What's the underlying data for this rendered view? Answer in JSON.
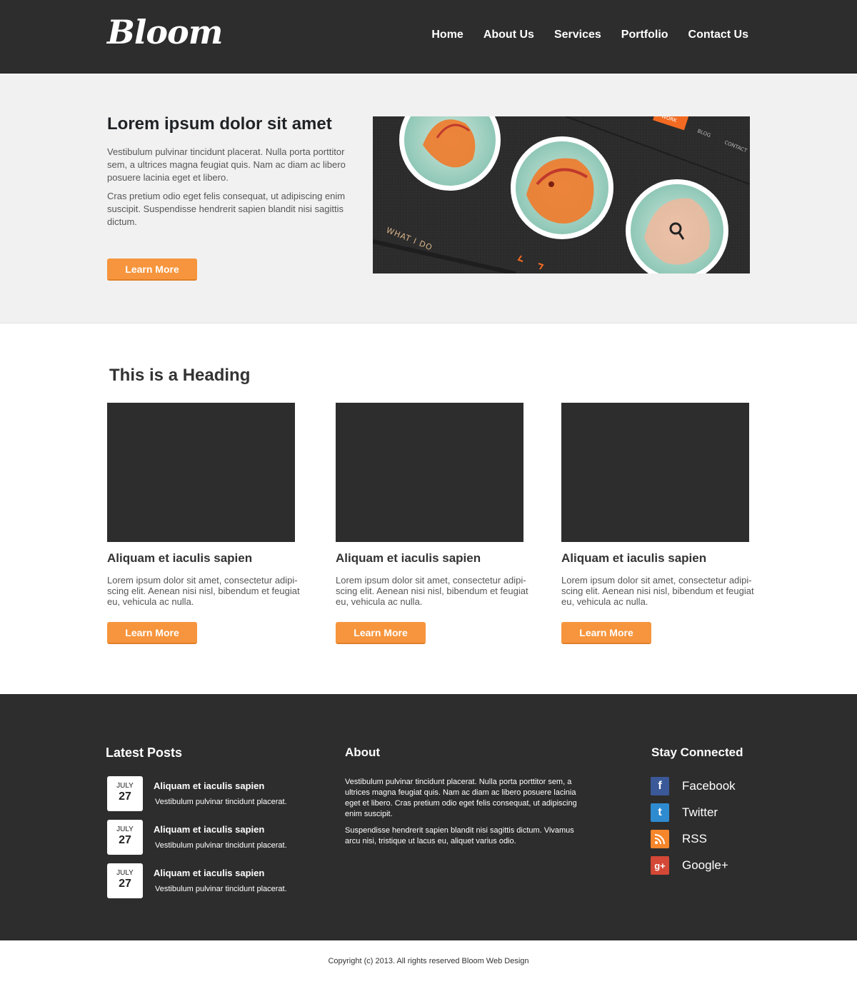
{
  "header": {
    "logo": "Bloom",
    "nav": [
      "Home",
      "About Us",
      "Services",
      "Portfolio",
      "Contact Us"
    ]
  },
  "hero": {
    "title": "Lorem ipsum dolor sit amet",
    "paragraph1": "Vestibulum pulvinar tincidunt placerat. Nulla porta porttitor sem, a ultrices magna feugiat quis. Nam ac diam ac libero posuere lacinia eget et libero.",
    "paragraph2": "Cras pretium odio eget felis consequat, ut adipiscing enim suscipit. Suspendisse hendrerit sapien blandit nisi sagittis dictum.",
    "button": "Learn More",
    "image": {
      "menu_work": "WORK",
      "menu_blog": "BLOG",
      "menu_contact": "CONTACT",
      "caption": "WHAT I DO"
    }
  },
  "features": {
    "heading": "This is a Heading",
    "cards": [
      {
        "title": "Aliquam et iaculis sapien",
        "text": "Lorem ipsum dolor sit amet, consectetur adipi-scing elit. Aenean nisi nisl, bibendum et feugiat eu, vehicula ac nulla.",
        "button": "Learn More"
      },
      {
        "title": "Aliquam et iaculis sapien",
        "text": "Lorem ipsum dolor sit amet, consectetur adipi-scing elit. Aenean nisi nisl, bibendum et feugiat eu, vehicula ac nulla.",
        "button": "Learn More"
      },
      {
        "title": "Aliquam et iaculis sapien",
        "text": "Lorem ipsum dolor sit amet, consectetur adipi-scing elit. Aenean nisi nisl, bibendum et feugiat eu, vehicula ac nulla.",
        "button": "Learn More"
      }
    ]
  },
  "footer": {
    "latest_posts": {
      "heading": "Latest Posts",
      "posts": [
        {
          "month": "JULY",
          "day": "27",
          "title": "Aliquam et iaculis sapien",
          "excerpt": "Vestibulum pulvinar tincidunt placerat."
        },
        {
          "month": "JULY",
          "day": "27",
          "title": "Aliquam et iaculis sapien",
          "excerpt": "Vestibulum pulvinar tincidunt placerat."
        },
        {
          "month": "JULY",
          "day": "27",
          "title": "Aliquam et iaculis sapien",
          "excerpt": "Vestibulum pulvinar tincidunt placerat."
        }
      ]
    },
    "about": {
      "heading": "About",
      "paragraph1": "Vestibulum pulvinar tincidunt placerat. Nulla porta porttitor sem, a ultrices magna feugiat quis. Nam ac diam ac libero posuere lacinia eget et libero. Cras pretium odio eget felis consequat, ut adipiscing enim suscipit.",
      "paragraph2": "Suspendisse hendrerit sapien blandit nisi sagittis dictum. Vivamus arcu nisi, tristique ut lacus eu, aliquet varius odio."
    },
    "stay_connected": {
      "heading": "Stay Connected",
      "links": [
        {
          "label": "Facebook",
          "icon": "facebook-icon",
          "glyph": "f",
          "color": "#3b5998"
        },
        {
          "label": "Twitter",
          "icon": "twitter-icon",
          "glyph": "t",
          "color": "#2f8bd0"
        },
        {
          "label": "RSS",
          "icon": "rss-icon",
          "glyph": "",
          "color": "#f5862b"
        },
        {
          "label": "Google+",
          "icon": "google-plus-icon",
          "glyph": "g+",
          "color": "#d34836"
        }
      ]
    }
  },
  "copyright": "Copyright (c) 2013. All rights reserved Bloom Web Design",
  "colors": {
    "accent": "#f6953d",
    "dark": "#2d2d2d",
    "hero_bg": "#f1f1f1"
  }
}
